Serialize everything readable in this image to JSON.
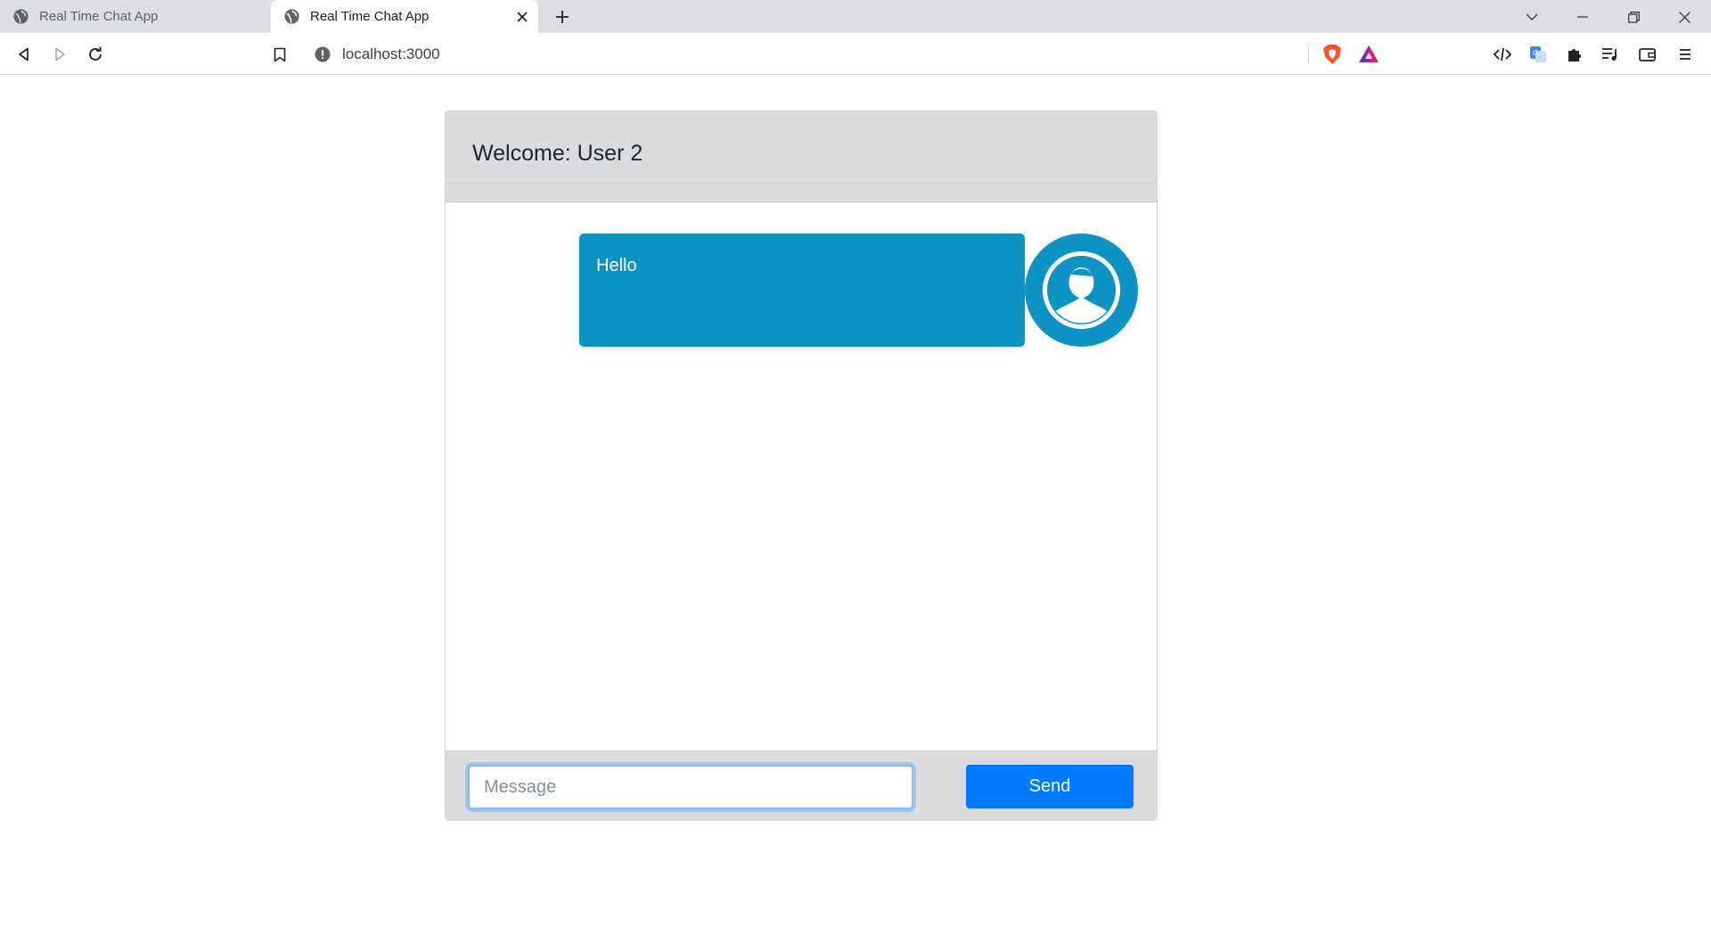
{
  "browser": {
    "tabs": [
      {
        "title": "Real Time Chat App",
        "active": false
      },
      {
        "title": "Real Time Chat App",
        "active": true
      }
    ],
    "url": "localhost:3000",
    "icons": {
      "tab": "globe-icon",
      "back": "back-arrow-icon",
      "forward": "forward-arrow-icon",
      "reload": "reload-icon",
      "bookmark": "bookmark-icon",
      "site_info": "info-icon",
      "shields": "brave-shields-icon",
      "rewards": "brave-rewards-icon",
      "devtools": "code-icon",
      "translate": "translate-icon",
      "extensions": "puzzle-icon",
      "media": "playlist-icon",
      "wallet": "wallet-icon",
      "menu": "menu-icon"
    }
  },
  "chat": {
    "header_title": "Welcome: User 2",
    "messages": [
      {
        "text": "Hello",
        "avatar": "user-avatar-icon"
      }
    ],
    "input_placeholder": "Message",
    "input_value": "",
    "send_label": "Send"
  },
  "colors": {
    "bubble": "#0b93c4",
    "send_button": "#007bff",
    "header_bg": "#dadcde",
    "input_focus": "#80bdff"
  }
}
